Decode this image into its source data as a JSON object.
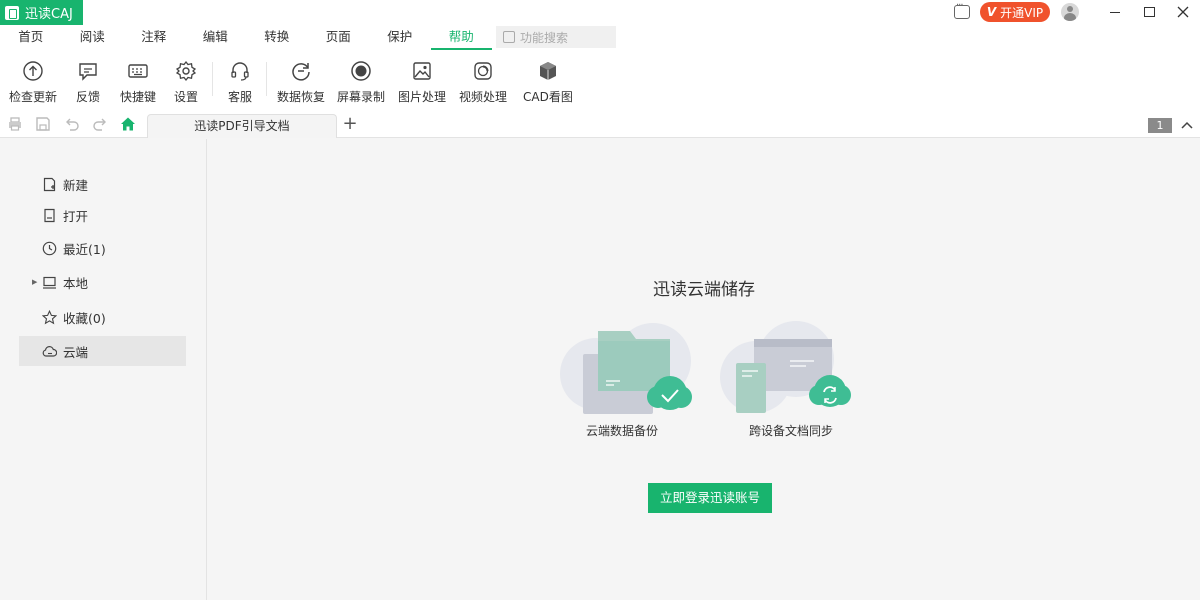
{
  "app": {
    "title": "迅读CAJ"
  },
  "titlebar": {
    "vip_prefix": "V",
    "vip_label": "开通VIP"
  },
  "menu": {
    "tabs": [
      "首页",
      "阅读",
      "注释",
      "编辑",
      "转换",
      "页面",
      "保护",
      "帮助"
    ],
    "active": "帮助",
    "search_placeholder": "功能搜索"
  },
  "ribbon": {
    "items": [
      {
        "label": "检查更新",
        "icon": "update-icon"
      },
      {
        "label": "反馈",
        "icon": "feedback-icon"
      },
      {
        "label": "快捷键",
        "icon": "keyboard-icon"
      },
      {
        "label": "设置",
        "icon": "gear-icon"
      },
      {
        "label": "客服",
        "icon": "headset-icon"
      },
      {
        "label": "数据恢复",
        "icon": "data-recovery-icon"
      },
      {
        "label": "屏幕录制",
        "icon": "record-icon"
      },
      {
        "label": "图片处理",
        "icon": "image-icon"
      },
      {
        "label": "视频处理",
        "icon": "video-icon"
      },
      {
        "label": "CAD看图",
        "icon": "cube-icon"
      }
    ]
  },
  "tabbar": {
    "doc_tab": "迅读PDF引导文档",
    "add": "+",
    "page_count": "1"
  },
  "sidebar": {
    "items": [
      {
        "label": "新建",
        "icon": "new-file-icon"
      },
      {
        "label": "打开",
        "icon": "open-file-icon"
      },
      {
        "label": "最近(1)",
        "icon": "clock-icon"
      },
      {
        "label": "本地",
        "icon": "monitor-icon"
      },
      {
        "label": "收藏(0)",
        "icon": "star-icon"
      },
      {
        "label": "云端",
        "icon": "cloud-icon"
      }
    ],
    "active": "云端"
  },
  "cloud": {
    "title": "迅读云端储存",
    "feature1": "云端数据备份",
    "feature2": "跨设备文档同步",
    "login_button": "立即登录迅读账号"
  },
  "colors": {
    "accent": "#18b46e",
    "vip": "#f0522c"
  }
}
